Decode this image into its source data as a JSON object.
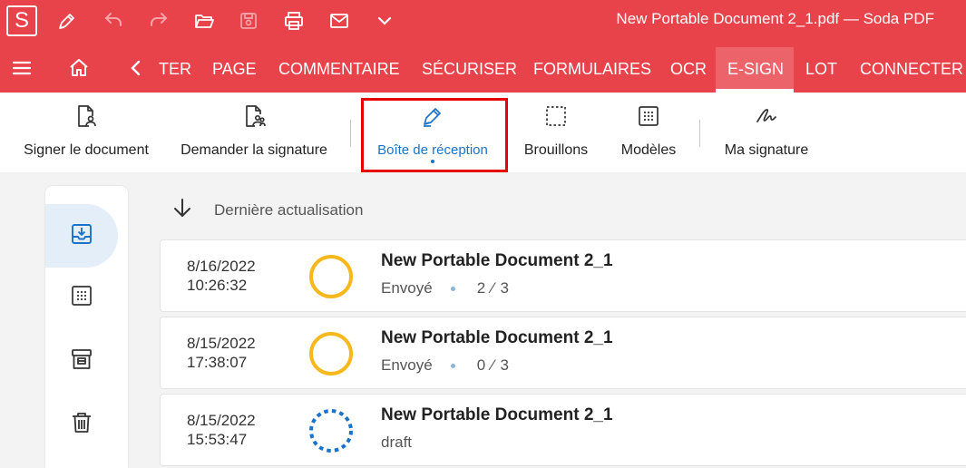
{
  "app": {
    "logo_letter": "S",
    "window_title": "New Portable Document 2_1.pdf  —  Soda PDF"
  },
  "titlebar": {
    "icons": [
      "pen-icon",
      "undo-icon",
      "redo-icon",
      "open-folder-icon",
      "save-icon",
      "print-icon",
      "mail-icon",
      "chevron-down-icon"
    ]
  },
  "ribbon": {
    "tabs": [
      {
        "label": "TER"
      },
      {
        "label": "PAGE"
      },
      {
        "label": "COMMENTAIRE"
      },
      {
        "label": "SÉCURISER"
      },
      {
        "label": "FORMULAIRES"
      },
      {
        "label": "OCR"
      },
      {
        "label": "E-SIGN",
        "active": true
      },
      {
        "label": "LOT"
      },
      {
        "label": "CONNECTER"
      }
    ]
  },
  "toolbar": {
    "items": [
      {
        "label": "Signer le document",
        "icon": "sign-document-icon"
      },
      {
        "label": "Demander la signature",
        "icon": "request-signature-icon"
      },
      {
        "label": "Boîte de réception",
        "icon": "pen-nib-icon",
        "active": true
      },
      {
        "label": "Brouillons",
        "icon": "draft-icon"
      },
      {
        "label": "Modèles",
        "icon": "template-icon"
      },
      {
        "label": "Ma signature",
        "icon": "signature-icon"
      }
    ]
  },
  "sidebar": {
    "items": [
      {
        "icon": "inbox-icon",
        "active": true
      },
      {
        "icon": "drafts-icon"
      },
      {
        "icon": "archive-icon"
      },
      {
        "icon": "trash-icon"
      }
    ]
  },
  "content": {
    "refresh_label": "Dernière actualisation",
    "documents": [
      {
        "date": "8/16/2022",
        "time": "10:26:32",
        "name": "New Portable Document 2_1",
        "status": "Envoyé",
        "signed": "2",
        "total": "3",
        "state": "sent"
      },
      {
        "date": "8/15/2022",
        "time": "17:38:07",
        "name": "New Portable Document 2_1",
        "status": "Envoyé",
        "signed": "0",
        "total": "3",
        "state": "sent"
      },
      {
        "date": "8/15/2022",
        "time": "15:53:47",
        "name": "New Portable Document 2_1",
        "status": "draft",
        "state": "draft"
      }
    ]
  },
  "colors": {
    "brand": "#e8424a",
    "accent": "#1a73c8",
    "pending": "#f6b81c",
    "highlight": "#e60000"
  }
}
